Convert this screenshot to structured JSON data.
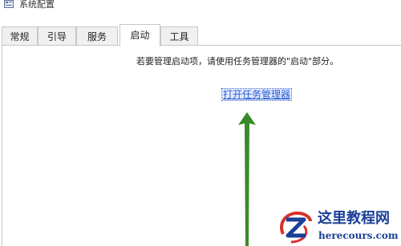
{
  "window": {
    "title": "系统配置",
    "icon": "system-config-icon"
  },
  "tabs": [
    {
      "label": "常规",
      "active": false
    },
    {
      "label": "引导",
      "active": false
    },
    {
      "label": "服务",
      "active": false
    },
    {
      "label": "启动",
      "active": true
    },
    {
      "label": "工具",
      "active": false
    }
  ],
  "startup": {
    "instruction": "若要管理启动项，请使用任务管理器的\"启动\"部分。",
    "open_task_manager_link": "打开任务管理器"
  },
  "annotation": {
    "arrow_color": "#3a8a2a",
    "arrow_direction": "up"
  },
  "watermark": {
    "title": "这里教程网",
    "url": "herecours.com",
    "brand_color": "#1a3f96",
    "accent_color": "#d8322a"
  }
}
